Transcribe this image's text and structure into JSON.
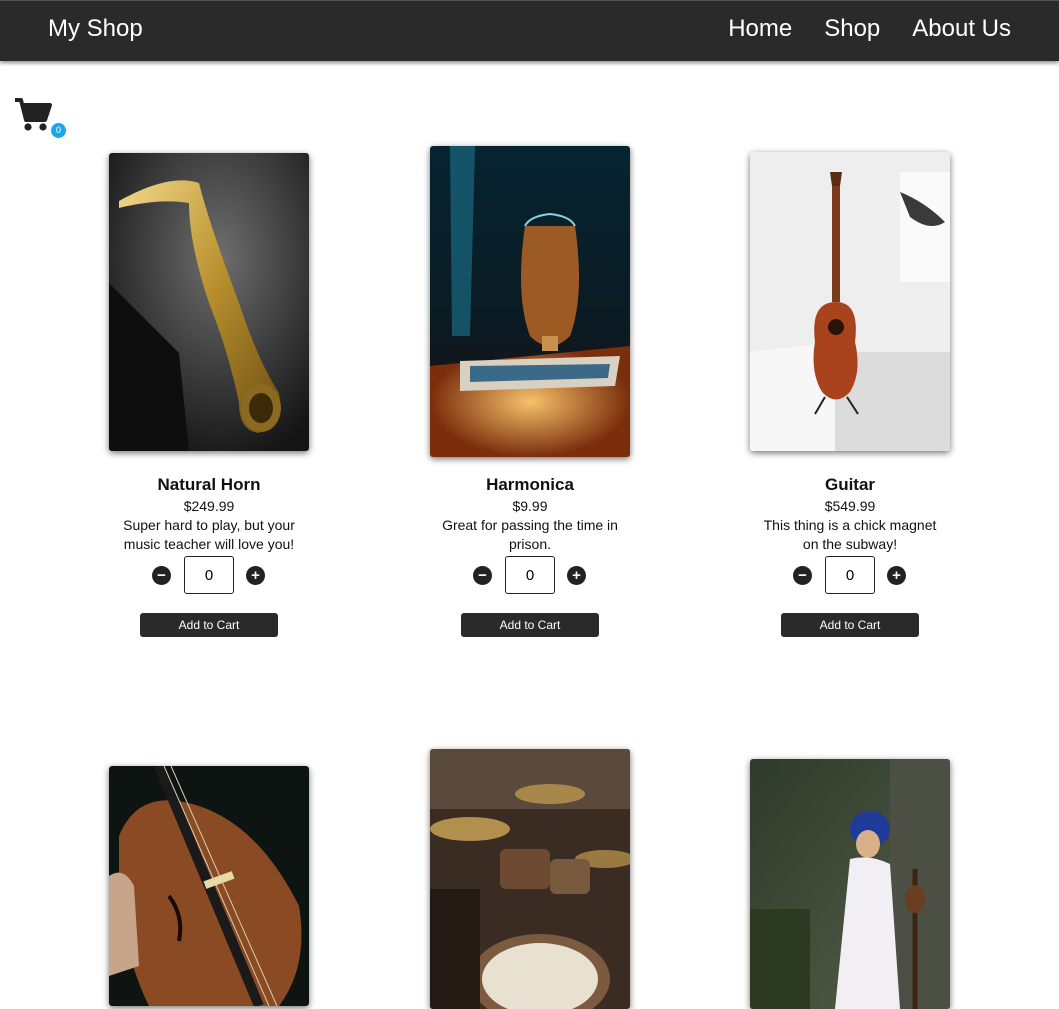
{
  "navbar": {
    "brand": "My Shop",
    "links": [
      "Home",
      "Shop",
      "About Us"
    ]
  },
  "cart": {
    "icon": "shopping-cart-icon",
    "count": "0"
  },
  "products": [
    {
      "name": "Natural Horn",
      "price": "$249.99",
      "description": "Super hard to play, but your music teacher will love you!",
      "quantity": "0",
      "add_label": "Add to Cart",
      "image": "saxophone-photo"
    },
    {
      "name": "Harmonica",
      "price": "$9.99",
      "description": "Great for passing the time in prison.",
      "quantity": "0",
      "add_label": "Add to Cart",
      "image": "harmonica-photo"
    },
    {
      "name": "Guitar",
      "price": "$549.99",
      "description": "This thing is a chick magnet on the subway!",
      "quantity": "0",
      "add_label": "Add to Cart",
      "image": "guitar-photo"
    },
    {
      "image": "violin-photo"
    },
    {
      "image": "drum-kit-photo"
    },
    {
      "image": "woman-with-instrument-photo"
    }
  ],
  "colors": {
    "navbar": "#2a2a2a",
    "badge": "#1aa7e8",
    "button": "#2a2a2a"
  }
}
